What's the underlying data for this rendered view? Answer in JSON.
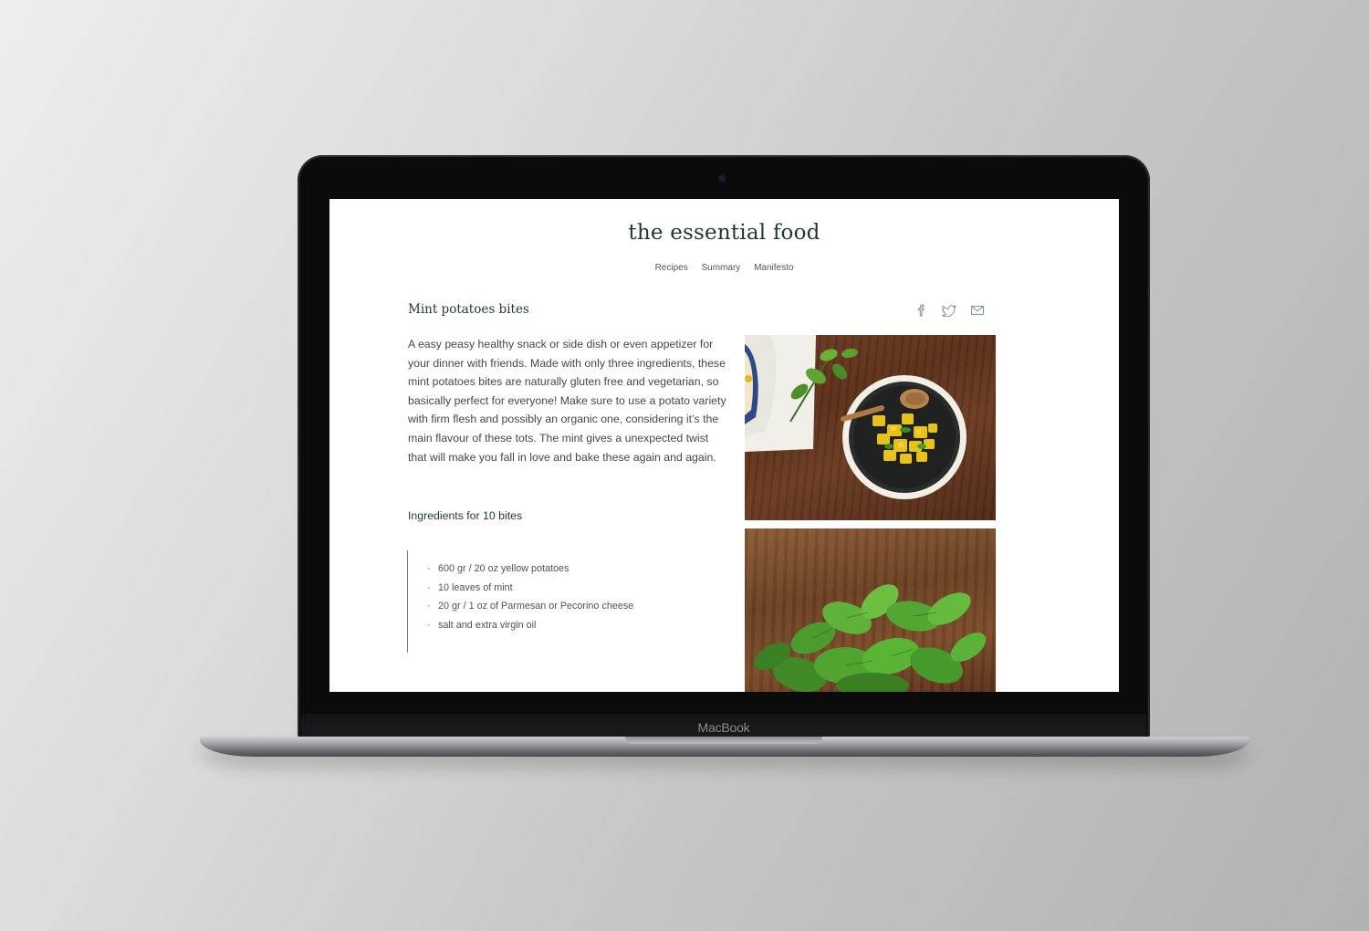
{
  "device": {
    "brand_label": "MacBook"
  },
  "site": {
    "title": "the essential food",
    "nav": [
      {
        "label": "Recipes"
      },
      {
        "label": "Summary"
      },
      {
        "label": "Manifesto"
      }
    ]
  },
  "article": {
    "title": "Mint potatoes bites",
    "intro": "A easy peasy healthy snack or side dish or even appetizer for your dinner with friends. Made with only three ingredients, these mint potatoes bites are naturally gluten free and vegetarian, so basically perfect for everyone! Make sure to use a potato variety with firm flesh and possibly an organic one, considering it’s the main flavour of these tots. The mint gives a unexpected twist that will make you fall in love and bake these again and again.",
    "ingredients_heading": "Ingredients for 10 bites",
    "ingredients": [
      "600 gr / 20 oz yellow potatoes",
      "10 leaves of mint",
      "20 gr / 1 oz of Parmesan or Pecorino cheese",
      "salt and extra virgin oil"
    ]
  },
  "share_icons": [
    "facebook-icon",
    "twitter-icon",
    "mail-icon"
  ],
  "colors": {
    "title_green": "#1f3a2c",
    "body_text": "#3f4a44",
    "screen_bg": "#ffffff",
    "bezel": "#0b0b0c"
  }
}
